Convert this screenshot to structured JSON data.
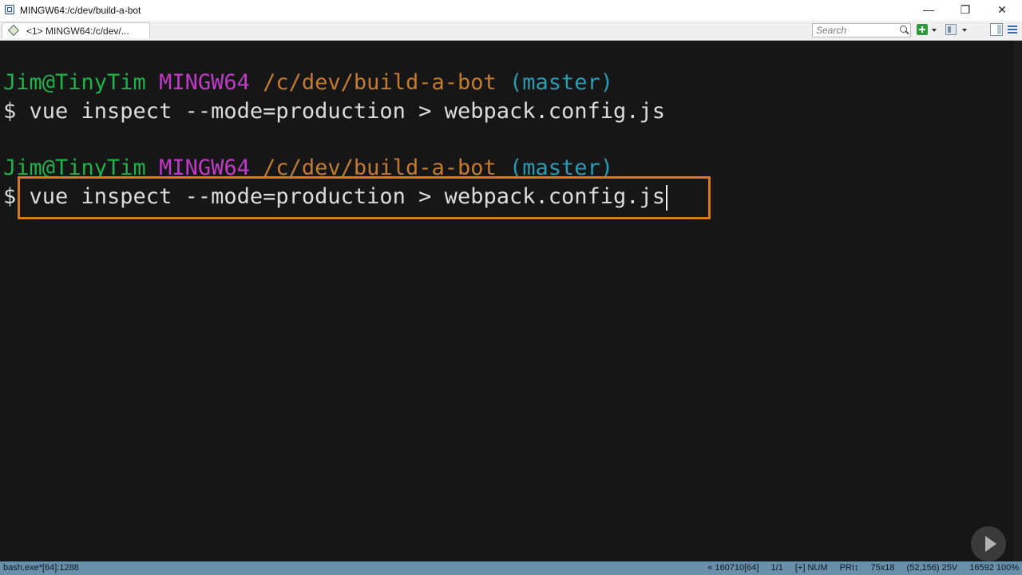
{
  "window": {
    "title": "MINGW64:/c/dev/build-a-bot",
    "minimize": "—",
    "restore": "❐",
    "close": "✕"
  },
  "tabs": [
    {
      "label": "<1>  MINGW64:/c/dev/..."
    }
  ],
  "toolbar": {
    "search_placeholder": "Search"
  },
  "terminal": {
    "prompt1": {
      "user": "Jim@TinyTim",
      "system": "MINGW64",
      "path": "/c/dev/build-a-bot",
      "branch": "(master)"
    },
    "command1": "$ vue inspect --mode=production > webpack.config.js",
    "prompt2": {
      "user": "Jim@TinyTim",
      "system": "MINGW64",
      "path": "/c/dev/build-a-bot",
      "branch": "(master)"
    },
    "command2": "$ vue inspect --mode=production > webpack.config.js"
  },
  "statusbar": {
    "left": "bash.exe*[64]:1288",
    "items": [
      "« 160710[64]",
      "1/1",
      "[+] NUM",
      "PRI↕",
      "75x18",
      "(52,156) 25V",
      "16592 100%"
    ]
  },
  "colors": {
    "prompt_user": "#1fb14a",
    "prompt_system": "#c13ac6",
    "prompt_path": "#c57a2f",
    "prompt_branch": "#2a9bb3",
    "highlight": "#d9771d",
    "statusbar_bg": "#6a8fa8"
  }
}
